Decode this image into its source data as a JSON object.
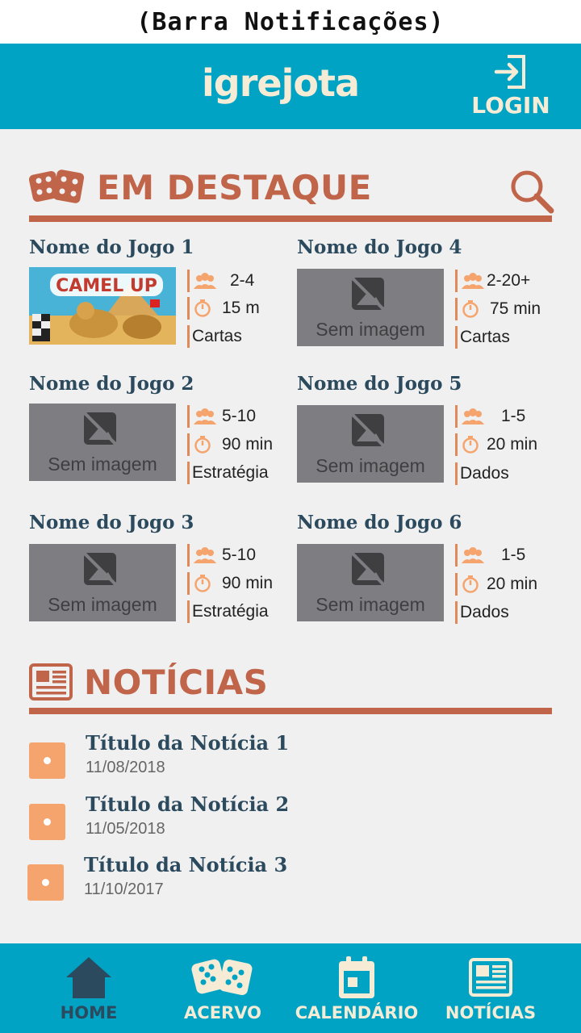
{
  "status_bar": {
    "text": "(Barra Notificações)"
  },
  "header": {
    "logo": "igrejota",
    "login_label": "LOGIN"
  },
  "featured": {
    "title": "EM DESTAQUE",
    "no_image_label": "Sem imagem",
    "games": [
      {
        "name": "Nome do Jogo 1",
        "players": "2-4",
        "time": "15 m",
        "type": "Cartas",
        "has_image": true,
        "image_text": "CAMEL UP"
      },
      {
        "name": "Nome do Jogo 2",
        "players": "5-10",
        "time": "90 min",
        "type": "Estratégia",
        "has_image": false
      },
      {
        "name": "Nome do Jogo 3",
        "players": "5-10",
        "time": "90 min",
        "type": "Estratégia",
        "has_image": false
      },
      {
        "name": "Nome do Jogo 4",
        "players": "2-20+",
        "time": "75 min",
        "type": "Cartas",
        "has_image": false
      },
      {
        "name": "Nome do Jogo 5",
        "players": "1-5",
        "time": "20 min",
        "type": "Dados",
        "has_image": false
      },
      {
        "name": "Nome do Jogo 6",
        "players": "1-5",
        "time": "20 min",
        "type": "Dados",
        "has_image": false
      }
    ]
  },
  "news": {
    "title": "NOTÍCIAS",
    "items": [
      {
        "title": "Título da Notícia 1",
        "date": "11/08/2018"
      },
      {
        "title": "Título da Notícia 2",
        "date": "11/05/2018"
      },
      {
        "title": "Título da Notícia 3",
        "date": "11/10/2017"
      }
    ]
  },
  "bottom_nav": {
    "items": [
      {
        "label": "HOME",
        "icon": "home-icon",
        "active": true
      },
      {
        "label": "ACERVO",
        "icon": "dice-icon",
        "active": false
      },
      {
        "label": "CALENDÁRIO",
        "icon": "calendar-icon",
        "active": false
      },
      {
        "label": "NOTÍCIAS",
        "icon": "newspaper-icon",
        "active": false
      }
    ]
  },
  "colors": {
    "header": "#00a3c4",
    "accent": "#c0654a",
    "orange": "#f5a46e",
    "title_text": "#2c4a5e",
    "background": "#f0f0f0"
  }
}
